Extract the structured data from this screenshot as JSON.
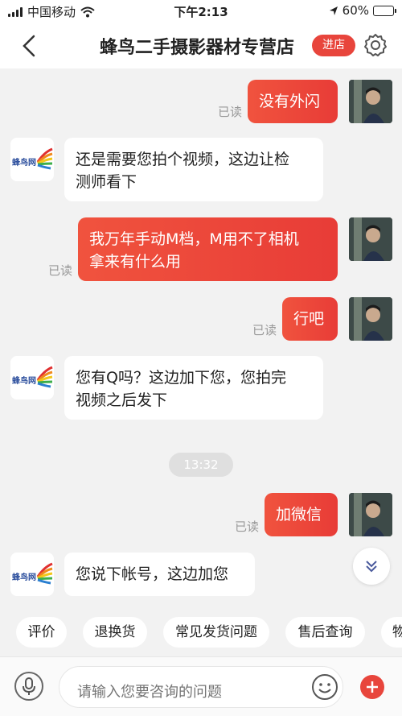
{
  "status": {
    "carrier": "中国移动",
    "time": "下午2:13",
    "battery": "60%",
    "battery_level": 0.6
  },
  "header": {
    "title": "蜂鸟二手摄影器材专营店",
    "enter_label": "进店"
  },
  "shop": {
    "logo_text": "蜂鸟网"
  },
  "messages": [
    {
      "from": "me",
      "text": "没有外闪",
      "read": "已读"
    },
    {
      "from": "them",
      "lines": [
        "还是需要您拍个视频，这边让检",
        "测师看下"
      ]
    },
    {
      "from": "me",
      "lines": [
        "我万年手动M档，M用不了相机",
        "拿来有什么用"
      ],
      "read": "已读"
    },
    {
      "from": "me",
      "text": "行吧",
      "read": "已读"
    },
    {
      "from": "them",
      "lines": [
        "您有Q吗？这边加下您，您拍完",
        "视频之后发下"
      ]
    },
    {
      "from": "me",
      "text": "加微信",
      "read": "已读"
    },
    {
      "from": "them",
      "text": "您说下帐号，这边加您"
    }
  ],
  "timestamp": "13:32",
  "quick_actions": [
    "评价",
    "退换货",
    "常见发货问题",
    "售后查询",
    "物"
  ],
  "input": {
    "placeholder": "请输入您要咨询的问题"
  },
  "colors": {
    "accent": "#e8453c",
    "bubble_me": "#ef4b3d",
    "bubble_them": "#ffffff",
    "background": "#f2f2f2"
  }
}
